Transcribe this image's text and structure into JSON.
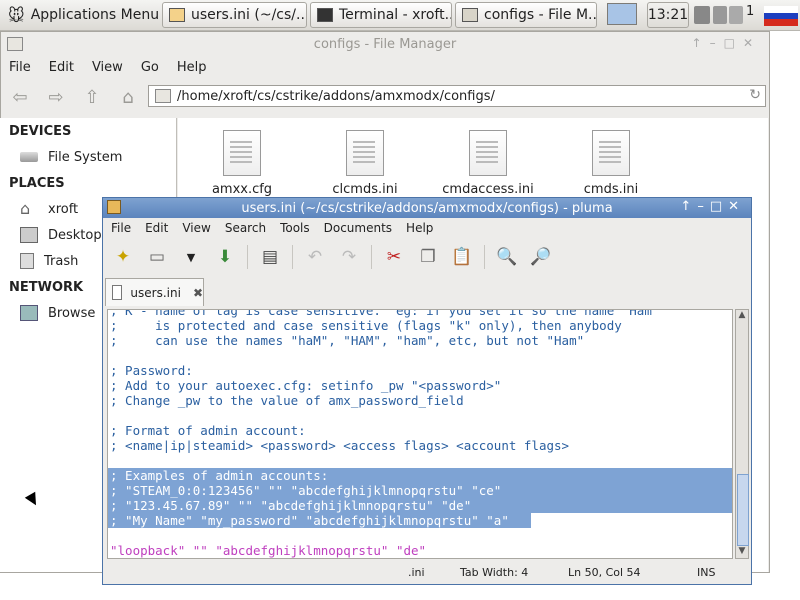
{
  "panel": {
    "app_menu_label": "Applications Menu",
    "tasks": [
      "users.ini (~/cs/...",
      "Terminal - xroft...",
      "configs - File M..."
    ],
    "clock": "13:21",
    "mail_count": "1"
  },
  "file_manager": {
    "title": "configs - File Manager",
    "menu": [
      "File",
      "Edit",
      "View",
      "Go",
      "Help"
    ],
    "path": "/home/xroft/cs/cstrike/addons/amxmodx/configs/",
    "sidebar": {
      "devices_heading": "DEVICES",
      "devices": [
        "File System"
      ],
      "places_heading": "PLACES",
      "places": [
        "xroft",
        "Desktop",
        "Trash"
      ],
      "network_heading": "NETWORK",
      "network": [
        "Browse"
      ]
    },
    "files": [
      "amxx.cfg",
      "clcmds.ini",
      "cmdaccess.ini",
      "cmds.ini"
    ]
  },
  "editor": {
    "title": "users.ini (~/cs/cstrike/addons/amxmodx/configs) - pluma",
    "menu": [
      "File",
      "Edit",
      "View",
      "Search",
      "Tools",
      "Documents",
      "Help"
    ],
    "tab_label": "users.ini",
    "lines": [
      "; K - name of tag is case sensitive.  eg: if you set it so the name \"Ham\"",
      ";     is protected and case sensitive (flags \"k\" only), then anybody",
      ";     can use the names \"haM\", \"HAM\", \"ham\", etc, but not \"Ham\"",
      "",
      "; Password:",
      "; Add to your autoexec.cfg: setinfo _pw \"<password>\"",
      "; Change _pw to the value of amx_password_field",
      "",
      "; Format of admin account:",
      "; <name|ip|steamid> <password> <access flags> <account flags>",
      "",
      "; Examples of admin accounts:",
      "; \"STEAM_0:0:123456\" \"\" \"abcdefghijklmnopqrstu\" \"ce\"",
      "; \"123.45.67.89\" \"\" \"abcdefghijklmnopqrstu\" \"de\"",
      "; \"My Name\" \"my_password\" \"abcdefghijklmnopqrstu\" \"a\"",
      "",
      "\"loopback\" \"\" \"abcdefghijklmnopqrstu\" \"de\""
    ],
    "status": {
      "language": ".ini",
      "tab_width": "Tab Width: 4",
      "position": "Ln 50, Col 54",
      "mode": "INS"
    }
  },
  "colors": {
    "selection": "#7ea3d4",
    "comment_text": "#2a5fa0",
    "string_text": "#bf3fbf",
    "pluma_titlebar": "#5b84bd"
  }
}
